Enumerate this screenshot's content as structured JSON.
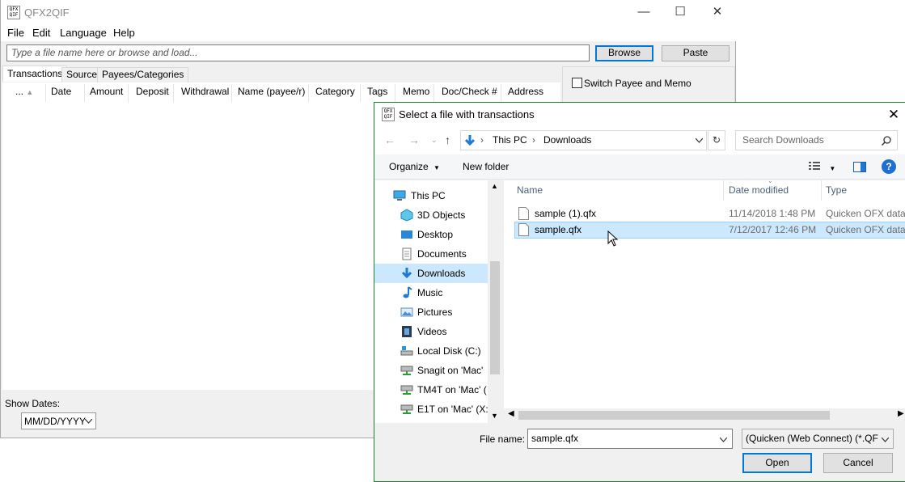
{
  "app": {
    "logo": "QFX QIF",
    "title": "QFX2QIF",
    "window_buttons": {
      "minimize": "—",
      "maximize": "☐",
      "close": "✕"
    },
    "menu": [
      "File",
      "Edit",
      "Language",
      "Help"
    ],
    "file_input_placeholder": "Type a file name here or browse and load...",
    "browse_label": "Browse",
    "paste_label": "Paste",
    "tabs": [
      "Transactions",
      "Source",
      "Payees/Categories"
    ],
    "columns": [
      "...",
      "Date",
      "Amount",
      "Deposit",
      "Withdrawal",
      "Name (payee/r)",
      "Category",
      "Tags",
      "Memo",
      "Doc/Check #",
      "Address"
    ],
    "switch_label": "Switch Payee and Memo",
    "show_dates_label": "Show Dates:",
    "date_format": "MM/DD/YYYY"
  },
  "dialog": {
    "logo": "QFX QIF",
    "title": "Select a file with transactions",
    "close": "✕",
    "breadcrumb": [
      "This PC",
      "Downloads"
    ],
    "search_placeholder": "Search Downloads",
    "organize_label": "Organize",
    "new_folder_label": "New folder",
    "nav_items": [
      {
        "label": "This PC",
        "icon": "pc-icon"
      },
      {
        "label": "3D Objects",
        "icon": "3d-objects-icon"
      },
      {
        "label": "Desktop",
        "icon": "desktop-icon"
      },
      {
        "label": "Documents",
        "icon": "documents-icon"
      },
      {
        "label": "Downloads",
        "icon": "downloads-icon",
        "selected": true
      },
      {
        "label": "Music",
        "icon": "music-icon"
      },
      {
        "label": "Pictures",
        "icon": "pictures-icon"
      },
      {
        "label": "Videos",
        "icon": "videos-icon"
      },
      {
        "label": "Local Disk (C:)",
        "icon": "disk-icon"
      },
      {
        "label": "Snagit on 'Mac'",
        "icon": "network-drive-icon"
      },
      {
        "label": "TM4T on 'Mac' (",
        "icon": "network-drive-icon"
      },
      {
        "label": "E1T on 'Mac' (X:",
        "icon": "network-drive-icon"
      }
    ],
    "columns": [
      "Name",
      "Date modified",
      "Type"
    ],
    "files": [
      {
        "name": "sample (1).qfx",
        "date": "11/14/2018 1:48 PM",
        "type": "Quicken OFX data"
      },
      {
        "name": "sample.qfx",
        "date": "7/12/2017 12:46 PM",
        "type": "Quicken OFX data",
        "selected": true
      }
    ],
    "file_name_label": "File name:",
    "file_name_value": "sample.qfx",
    "file_type": "(Quicken (Web Connect) (*.QF",
    "open_label": "Open",
    "cancel_label": "Cancel"
  },
  "colors": {
    "accent": "#0078d7",
    "selection": "#cce8ff",
    "dialog_border": "#1a7f2c"
  }
}
